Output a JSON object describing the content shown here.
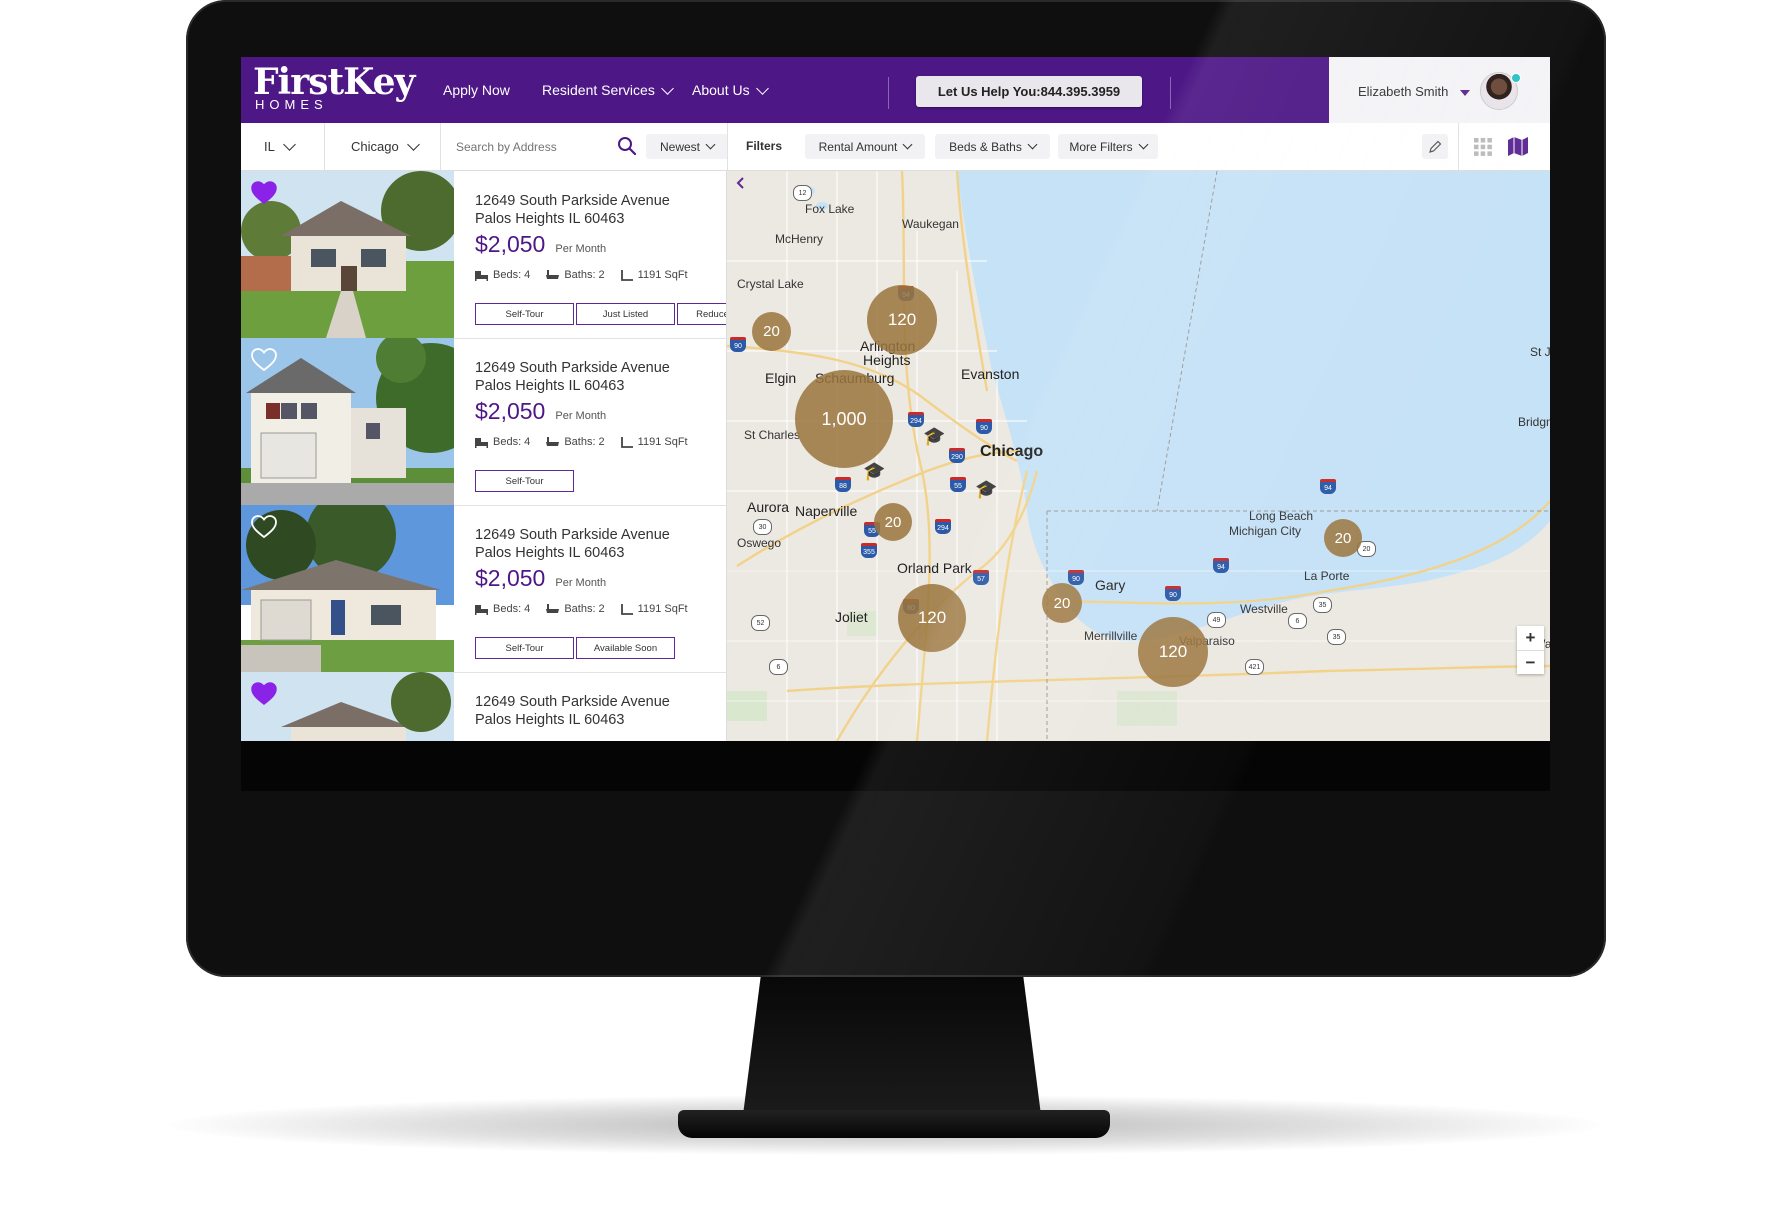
{
  "header": {
    "logo_name": "FirstKey",
    "logo_sub": "HOMES",
    "nav": [
      {
        "label": "Apply Now",
        "has_dropdown": false
      },
      {
        "label": "Resident Services",
        "has_dropdown": true
      },
      {
        "label": "About Us",
        "has_dropdown": true
      }
    ],
    "call_button": "Let Us Help You:844.395.3959",
    "user_name": "Elizabeth Smith",
    "brand_color": "#4d1786"
  },
  "toolbar": {
    "state": "IL",
    "city": "Chicago",
    "search_placeholder": "Search by Address",
    "sort": "Newest",
    "filters_label": "Filters",
    "filter_pills": [
      "Rental Amount",
      "Beds & Baths",
      "More Filters"
    ]
  },
  "listings": [
    {
      "address_line1": "12649 South Parkside Avenue",
      "address_line2": "Palos Heights IL 60463",
      "price": "$2,050",
      "per": "Per Month",
      "beds": "Beds: 4",
      "baths": "Baths: 2",
      "sqft": "1191 SqFt",
      "favorite": true,
      "tags": [
        "Self-Tour",
        "Just Listed",
        "Reduced Rate"
      ]
    },
    {
      "address_line1": "12649 South Parkside Avenue",
      "address_line2": "Palos Heights IL 60463",
      "price": "$2,050",
      "per": "Per Month",
      "beds": "Beds: 4",
      "baths": "Baths: 2",
      "sqft": "1191 SqFt",
      "favorite": false,
      "tags": [
        "Self-Tour"
      ]
    },
    {
      "address_line1": "12649 South Parkside Avenue",
      "address_line2": "Palos Heights IL 60463",
      "price": "$2,050",
      "per": "Per Month",
      "beds": "Beds: 4",
      "baths": "Baths: 2",
      "sqft": "1191 SqFt",
      "favorite": false,
      "tags": [
        "Self-Tour",
        "Available Soon"
      ]
    },
    {
      "address_line1": "12649 South Parkside Avenue",
      "address_line2": "Palos Heights IL 60463",
      "favorite": true
    }
  ],
  "map": {
    "places": {
      "chicago": "Chicago",
      "evanston": "Evanston",
      "waukegan": "Waukegan",
      "fox_lake": "Fox Lake",
      "mchenry": "McHenry",
      "crystal_lake": "Crystal Lake",
      "elgin": "Elgin",
      "schaumburg": "Schaumburg",
      "arlington1": "Arlington",
      "arlington2": "Heights",
      "st_charles": "St Charles",
      "aurora": "Aurora",
      "naperville": "Naperville",
      "oswego": "Oswego",
      "orland_park": "Orland Park",
      "joliet": "Joliet",
      "gary": "Gary",
      "merrillville": "Merrillville",
      "valparaiso": "Valparaiso",
      "westville": "Westville",
      "la_porte": "La Porte",
      "michigan_city": "Michigan City",
      "long_beach": "Long Beach",
      "bridgman": "Bridgma",
      "st_j": "St J",
      "wa": "Wa"
    },
    "clusters": [
      "20",
      "120",
      "1,000",
      "20",
      "120",
      "20",
      "120",
      "20"
    ],
    "highways": [
      "94",
      "90",
      "294",
      "90",
      "290",
      "88",
      "55",
      "294",
      "55",
      "355",
      "57",
      "90",
      "94",
      "90",
      "94",
      "80"
    ],
    "routes": [
      "12",
      "30",
      "52",
      "6",
      "49",
      "6",
      "35",
      "35",
      "421",
      "20"
    ],
    "water_color": "#c6e2f7",
    "land_color": "#ece9e2",
    "cluster_color": "#9b763e"
  }
}
